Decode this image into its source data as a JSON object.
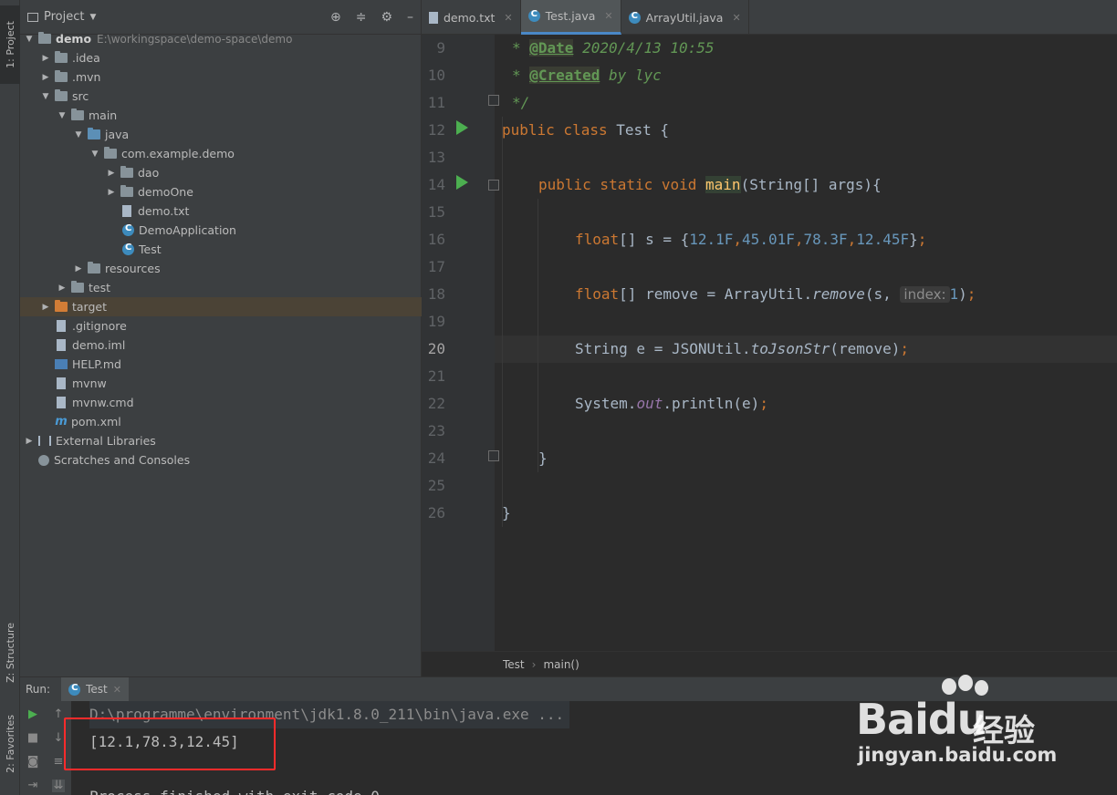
{
  "left_strip": {
    "project_tab": "1: Project",
    "structure_tab": "Z: Structure",
    "favorites_tab": "2: Favorites"
  },
  "project": {
    "title": "Project",
    "tree": [
      {
        "label": "demo",
        "extra": "E:\\workingspace\\demo-space\\demo"
      },
      {
        "label": ".idea"
      },
      {
        "label": ".mvn"
      },
      {
        "label": "src"
      },
      {
        "label": "main"
      },
      {
        "label": "java"
      },
      {
        "label": "com.example.demo"
      },
      {
        "label": "dao"
      },
      {
        "label": "demoOne"
      },
      {
        "label": "demo.txt"
      },
      {
        "label": "DemoApplication"
      },
      {
        "label": "Test"
      },
      {
        "label": "resources"
      },
      {
        "label": "test"
      },
      {
        "label": "target"
      },
      {
        "label": ".gitignore"
      },
      {
        "label": "demo.iml"
      },
      {
        "label": "HELP.md"
      },
      {
        "label": "mvnw"
      },
      {
        "label": "mvnw.cmd"
      },
      {
        "label": "pom.xml"
      },
      {
        "label": "External Libraries"
      },
      {
        "label": "Scratches and Consoles"
      }
    ]
  },
  "editor": {
    "tabs": [
      {
        "label": "demo.txt"
      },
      {
        "label": "Test.java"
      },
      {
        "label": "ArrayUtil.java"
      }
    ],
    "line_numbers": [
      "9",
      "10",
      "11",
      "12",
      "13",
      "14",
      "15",
      "16",
      "17",
      "18",
      "19",
      "20",
      "21",
      "22",
      "23",
      "24",
      "25",
      "26"
    ],
    "code": {
      "l9_tag": "@Date",
      "l9_text": " 2020/4/13 10:55",
      "l10_tag": "@Created",
      "l10_text": " by lyc",
      "l11": "*/",
      "l12_kw": "public class ",
      "l12_rest": "Test {",
      "l14_kw": "public static void ",
      "l14_fn": "main",
      "l14_rest": "(String[] args){",
      "l16_kw": "float",
      "l16_a": "[] s = {",
      "l16_n1": "12.1F",
      "l16_n2": "45.01F",
      "l16_n3": "78.3F",
      "l16_n4": "12.45F",
      "l16_end": "}",
      "l18_kw": "float",
      "l18_a": "[] remove = ArrayUtil.",
      "l18_m": "remove",
      "l18_b": "(s, ",
      "l18_hint": "index:",
      "l18_n": "1",
      "l18_end": ")",
      "l20_a": "String e = JSONUtil.",
      "l20_m": "toJsonStr",
      "l20_b": "(remove)",
      "l22_a": "System.",
      "l22_f": "out",
      "l22_b": ".println(e)",
      "l24": "}",
      "l26": "}"
    },
    "breadcrumb": [
      "Test",
      "main()"
    ]
  },
  "run": {
    "label": "Run:",
    "tab": "Test",
    "console": [
      "D:\\programme\\environment\\jdk1.8.0_211\\bin\\java.exe ...",
      "[12.1,78.3,12.45]",
      "",
      "Process finished with exit code 0"
    ]
  },
  "watermark": {
    "logo_a": "Bai",
    "logo_b": "du",
    "logo_c": "经验",
    "url": "jingyan.baidu.com"
  }
}
